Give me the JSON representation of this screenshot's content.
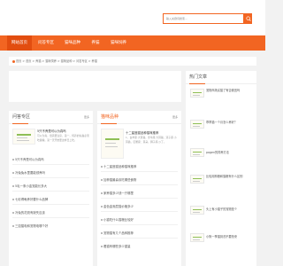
{
  "search": {
    "placeholder": "输入关键词搜索..."
  },
  "nav": {
    "items": [
      {
        "label": "网站首页",
        "active": true
      },
      {
        "label": "问答专区",
        "active": false
      },
      {
        "label": "猫咪品种",
        "active": false
      },
      {
        "label": "养猫",
        "active": false
      },
      {
        "label": "猫咪饲养",
        "active": false
      }
    ]
  },
  "breadcrumb": {
    "text": "首页 > 首页 > 养猫 > 猫咪饲养 > 猫咪品种 > 问答专区 > 养猫"
  },
  "qa_panel": {
    "title": "问答专区",
    "more": "更多",
    "featured": {
      "title": "5只不养是可以为真吗",
      "desc": "可以为真，但需要注意，第一，饲养的先猫必须吃猫粮，第一天开始要这样日上吃。"
    },
    "list": [
      "5只不养是可以为真吗",
      "冷兔兔水里要能领养吗",
      "5毛一条小金宠能长多大",
      "七彩得龟养好要什么品牌",
      "冷兔的花斑有缺失应该",
      "三如猫电和宠物电哪个好"
    ]
  },
  "breeds_panel": {
    "title": "猫咪品种",
    "more": "更多",
    "featured": {
      "title": "十二星座猫品种猫咪推荐",
      "desc": "1、白羊座·大耳猫。金牛座·大耳猫，双子座·小耳猫，巨蟹座：耳朵。狮子座·沙丁。"
    },
    "list": [
      "十二星座猫品种猫咪推荐",
      "加菲猫最喜欢吃哪些食物",
      "家养猫多少钱一只哪里",
      "金色金渐层猫价格多少",
      "小猫吃什么猫粮比较好",
      "宠物猫有几个品种推荐",
      "看猫有哪些多少重量"
    ]
  },
  "hot_panel": {
    "title": "热门文章",
    "items": [
      "宠物商场买猫了有否便宜吗",
      "乖乖猫一个月怎么养好？",
      "pagen的饲养方法",
      "比较用狗粮和猫粮有什么区别",
      "头上有小猫子的宠物是个",
      "小狗一季猫到洗不要抢来"
    ]
  }
}
